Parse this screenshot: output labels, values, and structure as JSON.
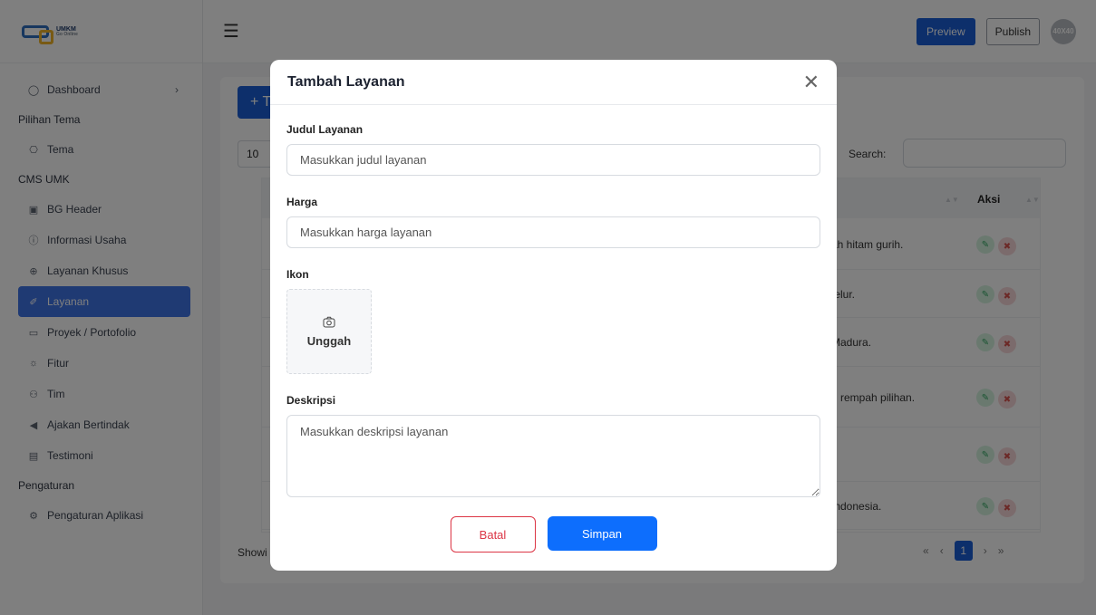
{
  "app": {
    "logo_text": "UMKM",
    "logo_sub": "Go Online"
  },
  "sidebar": {
    "items": [
      {
        "label": "Dashboard",
        "icon": "dashboard-icon",
        "type": "item"
      },
      {
        "label": "Pilihan Tema",
        "type": "section"
      },
      {
        "label": "Tema",
        "icon": "palette-icon",
        "type": "item"
      },
      {
        "label": "CMS UMK",
        "type": "section"
      },
      {
        "label": "BG Header",
        "icon": "image-icon",
        "type": "item"
      },
      {
        "label": "Informasi Usaha",
        "icon": "info-icon",
        "type": "item"
      },
      {
        "label": "Layanan Khusus",
        "icon": "plus-circle-icon",
        "type": "item"
      },
      {
        "label": "Layanan",
        "icon": "feather-icon",
        "type": "item",
        "active": true
      },
      {
        "label": "Proyek / Portofolio",
        "icon": "briefcase-icon",
        "type": "item"
      },
      {
        "label": "Fitur",
        "icon": "sun-icon",
        "type": "item"
      },
      {
        "label": "Tim",
        "icon": "people-icon",
        "type": "item"
      },
      {
        "label": "Ajakan Bertindak",
        "icon": "megaphone-icon",
        "type": "item"
      },
      {
        "label": "Testimoni",
        "icon": "message-icon",
        "type": "item"
      },
      {
        "label": "Pengaturan",
        "type": "section"
      },
      {
        "label": "Pengaturan Aplikasi",
        "icon": "gear-icon",
        "type": "item"
      }
    ]
  },
  "topbar": {
    "preview_label": "Preview",
    "publish_label": "Publish",
    "avatar_text": "40X40"
  },
  "page": {
    "add_button": "+ T",
    "entries_value": "10",
    "search_label": "Search:",
    "column_aksi": "Aksi",
    "rows": [
      "ah hitam gurih.",
      "telur.",
      "Madura.",
      "n rempah pilihan.",
      ".",
      "Indonesia."
    ],
    "showing_text": "Showi",
    "pager": {
      "first": "«",
      "prev": "‹",
      "current": "1",
      "next": "›",
      "last": "»"
    }
  },
  "modal": {
    "title": "Tambah Layanan",
    "judul_label": "Judul Layanan",
    "judul_placeholder": "Masukkan judul layanan",
    "harga_label": "Harga",
    "harga_placeholder": "Masukkan harga layanan",
    "ikon_label": "Ikon",
    "upload_label": "Unggah",
    "deskripsi_label": "Deskripsi",
    "deskripsi_placeholder": "Masukkan deskripsi layanan",
    "cancel_label": "Batal",
    "save_label": "Simpan"
  },
  "colors": {
    "primary": "#0d6efd",
    "sidebar_active": "#3f74e6",
    "danger": "#dc3545"
  }
}
